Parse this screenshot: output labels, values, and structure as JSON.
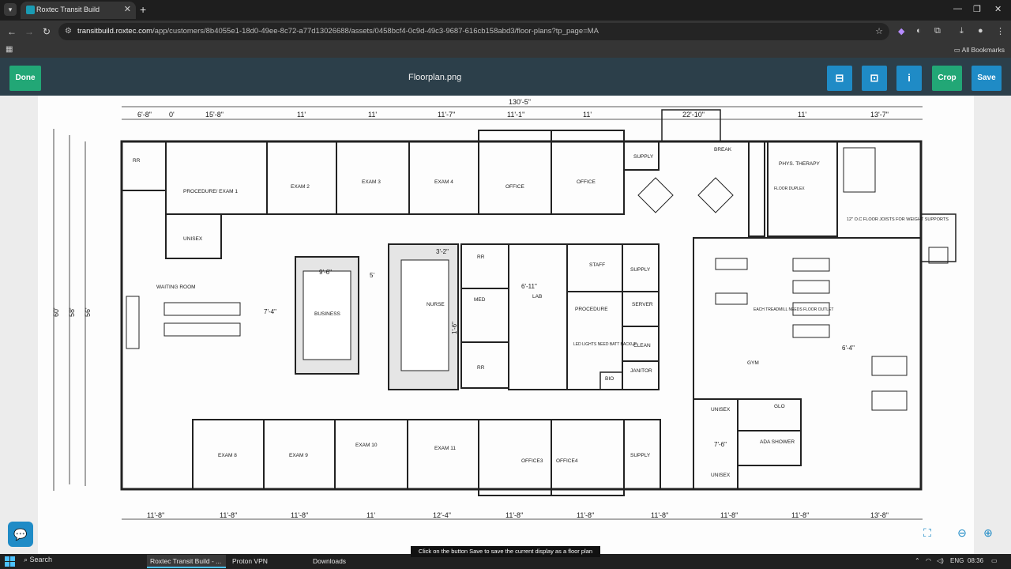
{
  "browser": {
    "tab_title": "Roxtec Transit Build",
    "url_domain": "transitbuild.roxtec.com",
    "url_path": "/app/customers/8b4055e1-18d0-49ee-8c72-a77d13026688/assets/0458bcf4-0c9d-49c3-9687-616cb158abd3/floor-plans?tp_page=MA",
    "bookmarks_label": "All Bookmarks"
  },
  "toolbar": {
    "done_label": "Done",
    "title": "Floorplan.png",
    "info_label": "i",
    "crop_label": "Crop",
    "save_label": "Save"
  },
  "floorplan": {
    "dims_top": [
      "130'-5\"",
      "6'-8\"",
      "0'",
      "15'-8\"",
      "11'",
      "11'",
      "11'-7\"",
      "11'-1\"",
      "11'",
      "22'-10\"",
      "11'",
      "13'-7\""
    ],
    "dims_bottom": [
      "11'-8\"",
      "11'-8\"",
      "11'-8\"",
      "11'",
      "12'-4\"",
      "11'-8\"",
      "11'-8\"",
      "11'-8\"",
      "11'-8\"",
      "11'-8\"",
      "13'-8\""
    ],
    "dims_left": [
      "60'",
      "58'",
      "56'"
    ],
    "rooms": [
      "RR",
      "PROCEDURE/ EXAM 1",
      "EXAM 2",
      "EXAM 3",
      "EXAM 4",
      "OFFICE",
      "OFFICE",
      "SUPPLY",
      "BREAK",
      "PHYS. THERAPY",
      "12\" O.C FLOOR JOISTS FOR WEIGHT SUPPORTS",
      "FLOOR DUPLEX",
      "UNISEX",
      "WAITING ROOM",
      "BUSINESS",
      "NURSE",
      "RR",
      "MED",
      "LAB",
      "RR",
      "STAFF",
      "SUPPLY",
      "PROCEDURE",
      "SERVER",
      "CLEAN",
      "JANITOR",
      "BIO",
      "LED LIGHTS NEED BATT BACKUP",
      "GYM",
      "EACH TREADMILL NEEDS FLOOR OUTLET",
      "UNISEX",
      "GLO",
      "ADA SHOWER",
      "UNISEX",
      "EXAM 8",
      "EXAM 9",
      "EXAM 10",
      "EXAM 11",
      "OFFICE3",
      "OFFICE4",
      "SUPPLY"
    ],
    "inner_dims": [
      "9'-6\"",
      "5'",
      "7'-4\"",
      "3'-2\"",
      "6'-11\"",
      "1'-6\"",
      "6'-4\"",
      "7'-6\""
    ]
  },
  "toast": "Click on the button Save to save the current display as a floor plan",
  "taskbar": {
    "search_label": "Search",
    "items": [
      "Roxtec Transit Build - ...",
      "Proton VPN",
      "Downloads"
    ],
    "lang": "ENG",
    "time": "08:36"
  },
  "colors": {
    "header_bg": "#2c3f4a",
    "done_green": "#22a776",
    "save_blue": "#1f8bc6"
  }
}
